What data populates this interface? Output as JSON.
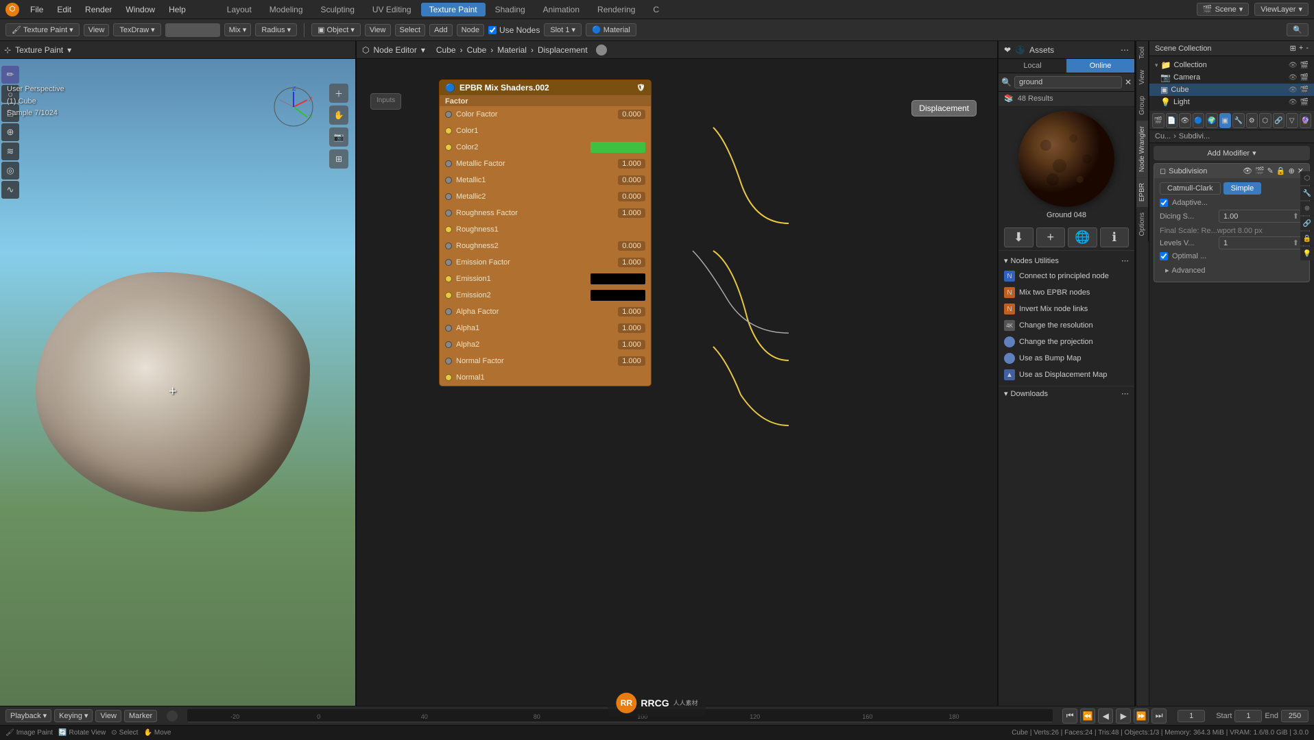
{
  "topMenu": {
    "logo": "⬡",
    "menus": [
      "File",
      "Edit",
      "Render",
      "Window",
      "Help"
    ],
    "workspaces": [
      "Layout",
      "Modeling",
      "Sculpting",
      "UV Editing",
      "Texture Paint",
      "Shading",
      "Animation",
      "Rendering"
    ],
    "activeWorkspace": "Layout",
    "scene": "Scene",
    "viewLayer": "ViewLayer"
  },
  "toolbar": {
    "mode": "Texture Paint",
    "view": "View",
    "tool": "TexDraw",
    "blendMode": "Mix",
    "radius": "Radius",
    "tools": [
      "Object",
      "View",
      "Select",
      "Add",
      "Node"
    ],
    "useNodes": true,
    "slot": "Slot 1",
    "material": "Material"
  },
  "viewport": {
    "title": "User Perspective",
    "object": "(1) Cube",
    "sample": "Sample 7/1024",
    "axisX": "X",
    "axisY": "Y",
    "axisZ": "Z"
  },
  "nodeEditor": {
    "header": "EPBR Mix Shaders.002",
    "breadcrumb": [
      "Cube",
      "Cube",
      "Material",
      "Displacement"
    ],
    "sections": {
      "factor": "Factor",
      "rows": [
        {
          "label": "Color Factor",
          "value": "0.000",
          "socketColor": "gray"
        },
        {
          "label": "Color1",
          "value": "",
          "socketColor": "yellow",
          "isSection": true
        },
        {
          "label": "Color2",
          "value": "",
          "socketColor": "yellow",
          "isSection": true,
          "hasColorSwatch": true,
          "swatchColor": "#40c040"
        },
        {
          "label": "Metallic Factor",
          "value": "1.000",
          "socketColor": "gray"
        },
        {
          "label": "Metallic1",
          "value": "0.000",
          "socketColor": "gray"
        },
        {
          "label": "Metallic2",
          "value": "0.000",
          "socketColor": "gray"
        },
        {
          "label": "Roughness Factor",
          "value": "1.000",
          "socketColor": "gray"
        },
        {
          "label": "Roughness1",
          "value": "",
          "socketColor": "yellow",
          "isSection": true
        },
        {
          "label": "Roughness2",
          "value": "0.000",
          "socketColor": "gray"
        },
        {
          "label": "Emission Factor",
          "value": "1.000",
          "socketColor": "gray"
        },
        {
          "label": "Emission1",
          "value": "",
          "socketColor": "yellow",
          "hasColorSwatch": true,
          "swatchColor": "#000000"
        },
        {
          "label": "Emission2",
          "value": "",
          "socketColor": "yellow",
          "hasColorSwatch": true,
          "swatchColor": "#000000"
        },
        {
          "label": "Alpha Factor",
          "value": "1.000",
          "socketColor": "gray"
        },
        {
          "label": "Alpha1",
          "value": "1.000",
          "socketColor": "gray"
        },
        {
          "label": "Alpha2",
          "value": "1.000",
          "socketColor": "gray"
        },
        {
          "label": "Normal Factor",
          "value": "1.000",
          "socketColor": "gray"
        },
        {
          "label": "Normal1",
          "value": "",
          "socketColor": "yellow",
          "isSection": true
        }
      ]
    }
  },
  "assets": {
    "title": "Assets",
    "tabs": [
      "Local",
      "Online"
    ],
    "activeTab": "Online",
    "searchPlaceholder": "ground",
    "resultCount": "48 Results",
    "previewName": "Ground 048",
    "actions": [
      "⬇",
      "+",
      "🌐",
      "ℹ"
    ],
    "nodesUtilities": {
      "title": "Nodes Utilities",
      "items": [
        {
          "label": "Connect to principled node",
          "color": "blue"
        },
        {
          "label": "Mix two EPBR nodes",
          "color": "orange"
        },
        {
          "label": "Invert Mix node links",
          "color": "orange"
        },
        {
          "label": "Change the resolution",
          "prefix": "4K"
        },
        {
          "label": "Change the projection",
          "prefix": "🔵"
        },
        {
          "label": "Use as Bump Map",
          "prefix": "🔵"
        },
        {
          "label": "Use as Displacement Map",
          "prefix": "🔵"
        }
      ]
    },
    "downloads": "Downloads"
  },
  "sceneTree": {
    "title": "Scene Collection",
    "items": [
      {
        "label": "Collection",
        "indent": 0,
        "expanded": true
      },
      {
        "label": "Camera",
        "indent": 1,
        "icon": "📷"
      },
      {
        "label": "Cube",
        "indent": 1,
        "icon": "▣",
        "active": true
      },
      {
        "label": "Light",
        "indent": 1,
        "icon": "💡"
      }
    ]
  },
  "properties": {
    "breadcrumb": [
      "Cu...",
      "Subdivi..."
    ],
    "addModifier": "Add Modifier",
    "subdivision": {
      "tabs": [
        "Catmull-Clark",
        "Simple"
      ],
      "activeTab": "Simple",
      "options": [
        {
          "label": "Adaptive...",
          "checked": true
        },
        {
          "label": "Dicing S...",
          "value": "1.00"
        },
        {
          "label": "Final Scale: Re...wport 8.00 px"
        },
        {
          "label": "Levels V...",
          "value": "1"
        },
        {
          "label": "Optimal ...",
          "checked": true
        }
      ],
      "advanced": "Advanced"
    }
  },
  "bottomBar": {
    "playback": "Playback",
    "keying": "Keying",
    "view": "View",
    "marker": "Marker",
    "start": "Start",
    "startValue": "1",
    "end": "End",
    "endValue": "250",
    "currentFrame": "1"
  },
  "statusBar": {
    "mode": "Image Paint",
    "action": "Rotate View",
    "select": "Select",
    "move": "Move",
    "info": "Cube | Verts:26 | Faces:24 | Tris:48 | Objects:1/3 | Memory: 364.3 MiB | VRAM: 1.6/8.0 GiB | 3.0.0"
  },
  "icons": {
    "triangle": "▲",
    "circle": "●",
    "gear": "⚙",
    "search": "🔍",
    "camera": "📷",
    "close": "✕",
    "chevronDown": "▾",
    "chevronRight": "▸",
    "download": "⬇",
    "globe": "🌐",
    "info": "ℹ",
    "plus": "+",
    "play": "▶",
    "pause": "⏸",
    "stop": "⏹",
    "skipBack": "⏮",
    "skipForward": "⏭",
    "stepBack": "⏪",
    "stepForward": "⏩",
    "dot": "⬤"
  }
}
